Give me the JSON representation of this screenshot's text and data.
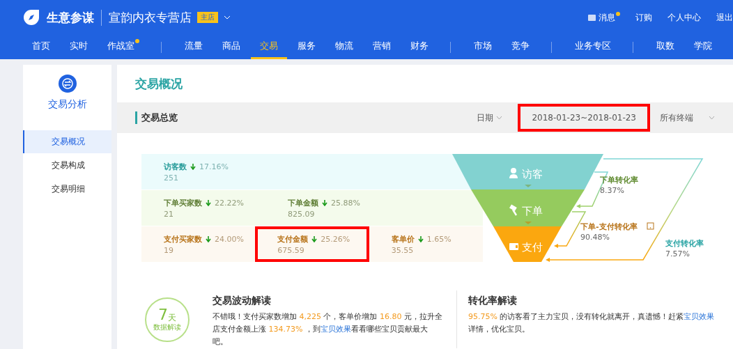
{
  "header": {
    "product": "生意参谋",
    "shop": "宣韵内衣专营店",
    "shop_badge": "主店",
    "actions": [
      {
        "label": "消息",
        "kind": "message",
        "unread": true
      },
      {
        "label": "订购",
        "kind": "plain"
      },
      {
        "label": "个人中心",
        "kind": "plain"
      },
      {
        "label": "退出",
        "kind": "plain"
      }
    ]
  },
  "nav": [
    {
      "label": "首页",
      "selected": false,
      "dot": false,
      "divider_before": false
    },
    {
      "label": "实时",
      "selected": false,
      "dot": false,
      "divider_before": false
    },
    {
      "label": "作战室",
      "selected": false,
      "dot": true,
      "divider_before": false
    },
    {
      "label": "流量",
      "selected": false,
      "dot": false,
      "divider_before": true
    },
    {
      "label": "商品",
      "selected": false,
      "dot": false,
      "divider_before": false
    },
    {
      "label": "交易",
      "selected": true,
      "dot": false,
      "divider_before": false
    },
    {
      "label": "服务",
      "selected": false,
      "dot": false,
      "divider_before": false
    },
    {
      "label": "物流",
      "selected": false,
      "dot": false,
      "divider_before": false
    },
    {
      "label": "营销",
      "selected": false,
      "dot": false,
      "divider_before": false
    },
    {
      "label": "财务",
      "selected": false,
      "dot": false,
      "divider_before": false
    },
    {
      "label": "市场",
      "selected": false,
      "dot": false,
      "divider_before": true
    },
    {
      "label": "竞争",
      "selected": false,
      "dot": false,
      "divider_before": false
    },
    {
      "label": "业务专区",
      "selected": false,
      "dot": false,
      "divider_before": true
    },
    {
      "label": "取数",
      "selected": false,
      "dot": false,
      "divider_before": true
    },
    {
      "label": "学院",
      "selected": false,
      "dot": false,
      "divider_before": false
    }
  ],
  "sidebar": {
    "title": "交易分析",
    "items": [
      {
        "label": "交易概况",
        "selected": true
      },
      {
        "label": "交易构成",
        "selected": false
      },
      {
        "label": "交易明细",
        "selected": false
      }
    ]
  },
  "page_title": "交易概况",
  "overview": {
    "title": "交易总览",
    "date_label": "日期",
    "date_range": "2018-01-23~2018-01-23",
    "date_range_highlighted": true,
    "device": "所有终端"
  },
  "metric_rows": [
    {
      "kind": "visitor",
      "metrics": [
        {
          "label": "访客数",
          "change": "17.16%",
          "value": "251",
          "highlighted": false
        }
      ]
    },
    {
      "kind": "order",
      "metrics": [
        {
          "label": "下单买家数",
          "change": "22.22%",
          "value": "21",
          "highlighted": false
        },
        {
          "label": "下单金额",
          "change": "25.88%",
          "value": "825.09",
          "highlighted": false
        }
      ]
    },
    {
      "kind": "pay",
      "metrics": [
        {
          "label": "支付买家数",
          "change": "24.00%",
          "value": "19",
          "highlighted": false
        },
        {
          "label": "支付金额",
          "change": "25.26%",
          "value": "675.59",
          "highlighted": true
        },
        {
          "label": "客单价",
          "change": "1.65%",
          "value": "35.55",
          "highlighted": false
        }
      ]
    }
  ],
  "funnel": {
    "stages": [
      {
        "kind": "visitor",
        "label": "访客",
        "color": "#82d2d0"
      },
      {
        "kind": "order",
        "label": "下单",
        "color": "#95cb5e"
      },
      {
        "kind": "pay",
        "label": "支付",
        "color": "#fba70f"
      }
    ],
    "rates": [
      {
        "label": "下单转化率",
        "value": "8.37%",
        "color": "#5f8a2f",
        "help": false
      },
      {
        "label": "下单-支付转化率",
        "value": "90.48%",
        "color": "#b8741a",
        "help": true
      },
      {
        "label": "支付转化率",
        "value": "7.57%",
        "color": "#2aa4a4",
        "help": false
      }
    ]
  },
  "insight_badge": {
    "number": "7",
    "unit": "天",
    "caption": "数据解读"
  },
  "insights": [
    {
      "title": "交易波动解读",
      "parts": [
        {
          "kind": "plain",
          "text": "不错哦！支付买家数增加 "
        },
        {
          "kind": "number",
          "text": "4,225"
        },
        {
          "kind": "plain",
          "text": " 个，客单价增加 "
        },
        {
          "kind": "number",
          "text": "16.80"
        },
        {
          "kind": "plain",
          "text": " 元，拉升全店支付金额上涨 "
        },
        {
          "kind": "number",
          "text": "134.73%"
        },
        {
          "kind": "plain",
          "text": " ，到"
        },
        {
          "kind": "link",
          "text": "宝贝效果"
        },
        {
          "kind": "plain",
          "text": "看看哪些宝贝贡献最大吧。"
        }
      ]
    },
    {
      "title": "转化率解读",
      "parts": [
        {
          "kind": "number",
          "text": "95.75%"
        },
        {
          "kind": "plain",
          "text": " 的访客看了主力宝贝，没有转化就离开，真遗憾！赶紧"
        },
        {
          "kind": "link",
          "text": "宝贝效果"
        },
        {
          "kind": "plain",
          "text": "详情，优化宝贝。"
        }
      ]
    }
  ]
}
